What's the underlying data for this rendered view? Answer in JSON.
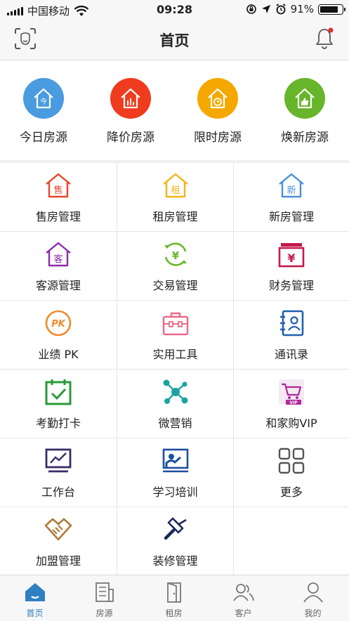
{
  "status_bar": {
    "carrier": "中国移动",
    "time": "09:28",
    "battery": "91%",
    "battery_level": 0.91
  },
  "nav": {
    "title": "首页",
    "left_icon": "scan-icon",
    "right_icon": "bell-icon",
    "has_notification_dot": true
  },
  "quick_actions": [
    {
      "label": "今日房源",
      "icon": "house-today-icon",
      "color": "#4a9be0"
    },
    {
      "label": "降价房源",
      "icon": "house-price-drop-icon",
      "color": "#f03c1e"
    },
    {
      "label": "限时房源",
      "icon": "house-clock-icon",
      "color": "#f5a800"
    },
    {
      "label": "焕新房源",
      "icon": "house-like-icon",
      "color": "#66b52a"
    }
  ],
  "grid_items": [
    {
      "label": "售房管理",
      "icon": "house-sale-icon",
      "color": "#e8452c",
      "glyph": "售"
    },
    {
      "label": "租房管理",
      "icon": "house-rent-icon",
      "color": "#f2b418",
      "glyph": "租"
    },
    {
      "label": "新房管理",
      "icon": "house-new-icon",
      "color": "#4a90d9",
      "glyph": "新"
    },
    {
      "label": "客源管理",
      "icon": "house-customer-icon",
      "color": "#8e2aa8",
      "glyph": "客"
    },
    {
      "label": "交易管理",
      "icon": "yen-exchange-icon",
      "color": "#6ab82c",
      "glyph": "¥"
    },
    {
      "label": "财务管理",
      "icon": "finance-box-icon",
      "color": "#c41a4a",
      "glyph": "¥"
    },
    {
      "label": "业绩 PK",
      "icon": "pk-icon",
      "color": "#f28a2e",
      "glyph": "PK"
    },
    {
      "label": "实用工具",
      "icon": "toolbox-icon",
      "color": "#e86a8a",
      "glyph": ""
    },
    {
      "label": "通讯录",
      "icon": "contacts-icon",
      "color": "#2060b0",
      "glyph": ""
    },
    {
      "label": "考勤打卡",
      "icon": "calendar-check-icon",
      "color": "#2a9a3a",
      "glyph": ""
    },
    {
      "label": "微营销",
      "icon": "network-icon",
      "color": "#1aa3a3",
      "glyph": ""
    },
    {
      "label": "和家购VIP",
      "icon": "vip-cart-icon",
      "color": "#b0289a",
      "glyph": "VIP"
    },
    {
      "label": "工作台",
      "icon": "workbench-icon",
      "color": "#3a2a6a",
      "glyph": ""
    },
    {
      "label": "学习培训",
      "icon": "training-icon",
      "color": "#1e4fa0",
      "glyph": ""
    },
    {
      "label": "更多",
      "icon": "more-grid-icon",
      "color": "#555555",
      "glyph": ""
    },
    {
      "label": "加盟管理",
      "icon": "handshake-icon",
      "color": "#b07a3a",
      "glyph": ""
    },
    {
      "label": "装修管理",
      "icon": "paint-roller-icon",
      "color": "#1a2a5a",
      "glyph": ""
    }
  ],
  "tab_bar": [
    {
      "label": "首页",
      "icon": "home-icon",
      "active": true
    },
    {
      "label": "房源",
      "icon": "building-icon",
      "active": false
    },
    {
      "label": "租房",
      "icon": "door-icon",
      "active": false
    },
    {
      "label": "客户",
      "icon": "people-icon",
      "active": false
    },
    {
      "label": "我的",
      "icon": "person-icon",
      "active": false
    }
  ],
  "colors": {
    "accent": "#2f7fc1",
    "bar_background": "#f7f7f7",
    "divider": "#e6e6e6"
  }
}
